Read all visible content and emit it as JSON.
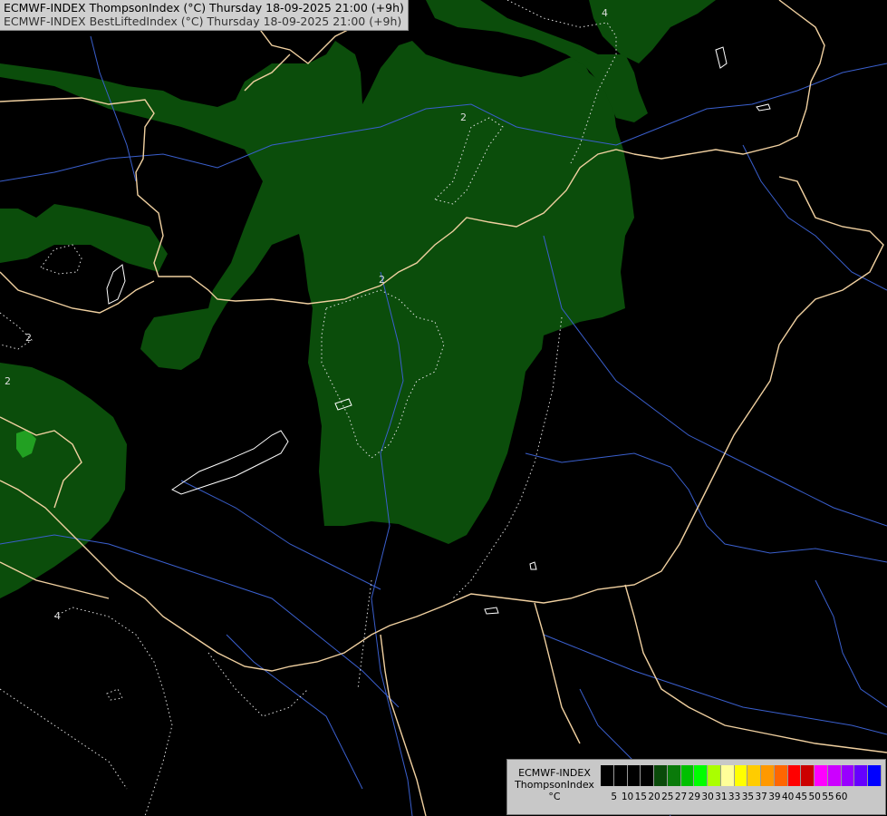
{
  "header": {
    "line1": "ECMWF-INDEX ThompsonIndex (°C) Thursday 18-09-2025 21:00 (+9h)",
    "line2": "ECMWF-INDEX BestLiftedIndex (°C) Thursday 18-09-2025 21:00 (+9h)"
  },
  "contour_labels": [
    "2",
    "2",
    "2",
    "2",
    "4",
    "4"
  ],
  "legend": {
    "title_lines": [
      "ECMWF-INDEX",
      "ThompsonIndex",
      "°C"
    ],
    "colors": [
      "#000000",
      "#000000",
      "#000000",
      "#000000",
      "#0a4a0a",
      "#0a7a0a",
      "#00c000",
      "#00ff00",
      "#aaff00",
      "#ffff99",
      "#ffff00",
      "#ffcc00",
      "#ff9900",
      "#ff6600",
      "#ff0000",
      "#cc0000",
      "#ff00ff",
      "#cc00ff",
      "#9900ff",
      "#6600ff",
      "#0000ff"
    ],
    "ticks": [
      "5",
      "10",
      "15",
      "20",
      "25",
      "27",
      "29",
      "30",
      "31",
      "33",
      "35",
      "37",
      "39",
      "40",
      "45",
      "50",
      "55",
      "60"
    ]
  },
  "colors": {
    "dark_green": "#0b4d0b",
    "bright_green": "#22a022",
    "border": "#f0d0a0",
    "river": "#3a5fcd"
  }
}
